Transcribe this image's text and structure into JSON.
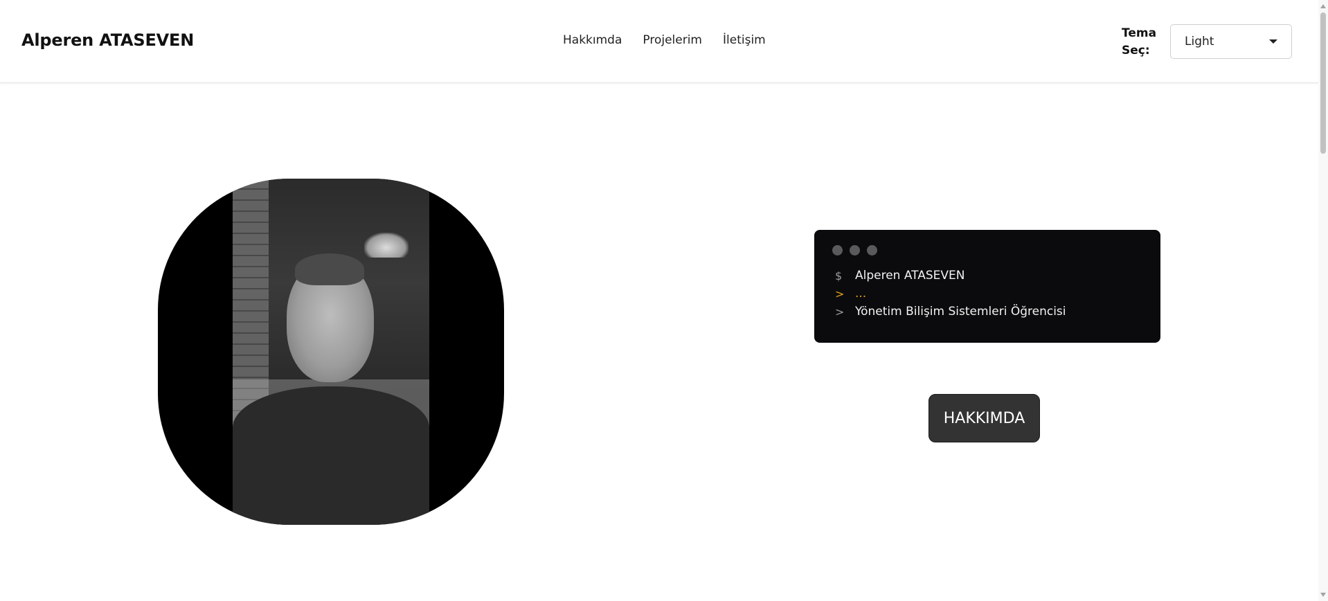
{
  "header": {
    "brand": "Alperen ATASEVEN",
    "nav": [
      "Hakkımda",
      "Projelerim",
      "İletişim"
    ],
    "theme_label_line1": "Tema",
    "theme_label_line2": "Seç:",
    "theme_value": "Light"
  },
  "hero": {
    "terminal": {
      "lines": [
        {
          "prompt": "$",
          "text": "Alperen ATASEVEN"
        },
        {
          "prompt": ">",
          "text": "..."
        },
        {
          "prompt": ">",
          "text": "Yönetim Bilişim Sistemleri Öğrencisi"
        }
      ]
    },
    "button_label": "HAKKIMDA"
  },
  "colors": {
    "terminal_bg": "#0b0b0d",
    "accent_orange": "#e3a21a",
    "button_bg": "#333333"
  },
  "icons": [
    "chevron-down-icon",
    "window-dot-icon",
    "scroll-arrow-icon"
  ]
}
